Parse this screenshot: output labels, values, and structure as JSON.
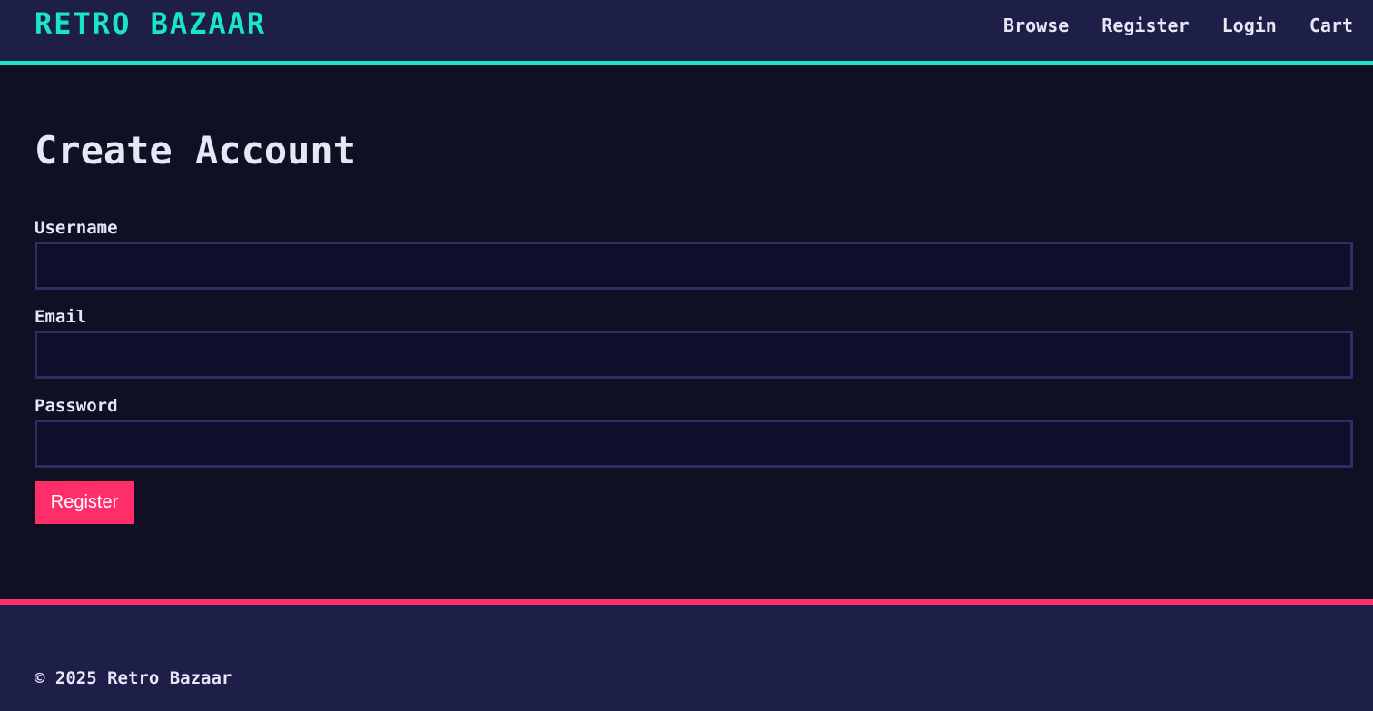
{
  "header": {
    "logo": "RETRO BAZAAR",
    "nav": [
      {
        "label": "Browse"
      },
      {
        "label": "Register"
      },
      {
        "label": "Login"
      },
      {
        "label": "Cart"
      }
    ]
  },
  "main": {
    "title": "Create Account",
    "fields": {
      "username": {
        "label": "Username",
        "value": "",
        "placeholder": ""
      },
      "email": {
        "label": "Email",
        "value": "",
        "placeholder": ""
      },
      "password": {
        "label": "Password",
        "value": "",
        "placeholder": ""
      }
    },
    "submit_label": "Register"
  },
  "footer": {
    "copyright": "© 2025 Retro Bazaar"
  },
  "colors": {
    "accent_teal": "#19e6c3",
    "accent_pink": "#ff2e6b",
    "header_bg": "#1e1f48",
    "page_bg": "#0f1023",
    "input_bg": "#0e0e2d",
    "input_border": "#2e2e63",
    "text": "#e6e6f5"
  }
}
